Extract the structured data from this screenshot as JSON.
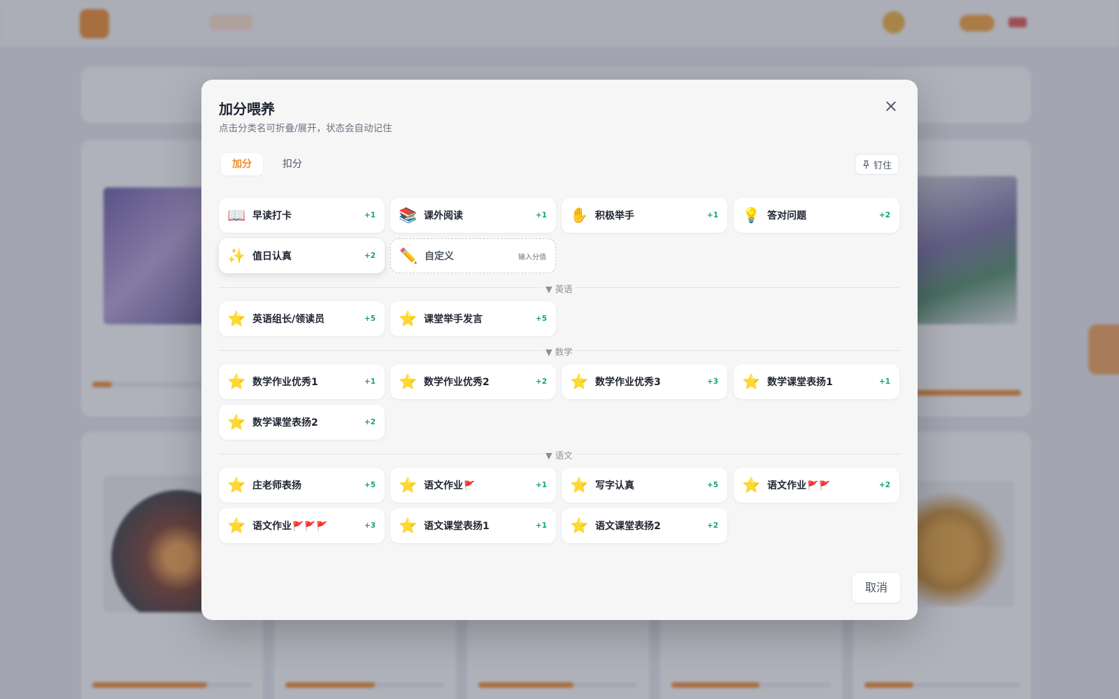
{
  "modal": {
    "title": "加分喂养",
    "subtitle": "点击分类名可折叠/展开，状态会自动记住",
    "tabs": [
      {
        "label": "加分",
        "active": true
      },
      {
        "label": "扣分",
        "active": false
      }
    ],
    "pin_label": "钉住",
    "cancel_label": "取消"
  },
  "general_items": [
    {
      "icon": "📖",
      "icon_name": "open-book-icon",
      "label": "早读打卡",
      "points": "+1"
    },
    {
      "icon": "📚",
      "icon_name": "books-icon",
      "label": "课外阅读",
      "points": "+1"
    },
    {
      "icon": "✋",
      "icon_name": "raised-hand-icon",
      "label": "积极举手",
      "points": "+1"
    },
    {
      "icon": "💡",
      "icon_name": "light-bulb-icon",
      "label": "答对问题",
      "points": "+2"
    },
    {
      "icon": "✨",
      "icon_name": "sparkles-icon",
      "label": "值日认真",
      "points": "+2"
    }
  ],
  "custom_item": {
    "icon": "✏️",
    "icon_name": "pencil-icon",
    "label": "自定义",
    "hint": "输入分值"
  },
  "categories": [
    {
      "name": "英语",
      "arrow": "▼",
      "items": [
        {
          "icon": "⭐",
          "label": "英语组长/领读员",
          "flags": "",
          "points": "+5"
        },
        {
          "icon": "⭐",
          "label": "课堂举手发言",
          "flags": "",
          "points": "+5"
        }
      ]
    },
    {
      "name": "数学",
      "arrow": "▼",
      "items": [
        {
          "icon": "⭐",
          "label": "数学作业优秀1",
          "flags": "",
          "points": "+1"
        },
        {
          "icon": "⭐",
          "label": "数学作业优秀2",
          "flags": "",
          "points": "+2"
        },
        {
          "icon": "⭐",
          "label": "数学作业优秀3",
          "flags": "",
          "points": "+3"
        },
        {
          "icon": "⭐",
          "label": "数学课堂表扬1",
          "flags": "",
          "points": "+1"
        },
        {
          "icon": "⭐",
          "label": "数学课堂表扬2",
          "flags": "",
          "points": "+2"
        }
      ]
    },
    {
      "name": "语文",
      "arrow": "▼",
      "items": [
        {
          "icon": "⭐",
          "label": "庄老师表扬",
          "flags": "",
          "points": "+5"
        },
        {
          "icon": "⭐",
          "label": "语文作业",
          "flags": "🚩",
          "points": "+1"
        },
        {
          "icon": "⭐",
          "label": "写字认真",
          "flags": "",
          "points": "+5"
        },
        {
          "icon": "⭐",
          "label": "语文作业",
          "flags": "🚩🚩",
          "points": "+2"
        },
        {
          "icon": "⭐",
          "label": "语文作业",
          "flags": "🚩🚩🚩",
          "points": "+3"
        },
        {
          "icon": "⭐",
          "label": "语文课堂表扬1",
          "flags": "",
          "points": "+1"
        },
        {
          "icon": "⭐",
          "label": "语文课堂表扬2",
          "flags": "",
          "points": "+2"
        }
      ]
    }
  ],
  "colors": {
    "accent": "#f08a2c",
    "points_green": "#17a36b",
    "overlay": "rgba(66,72,92,0.42)"
  }
}
